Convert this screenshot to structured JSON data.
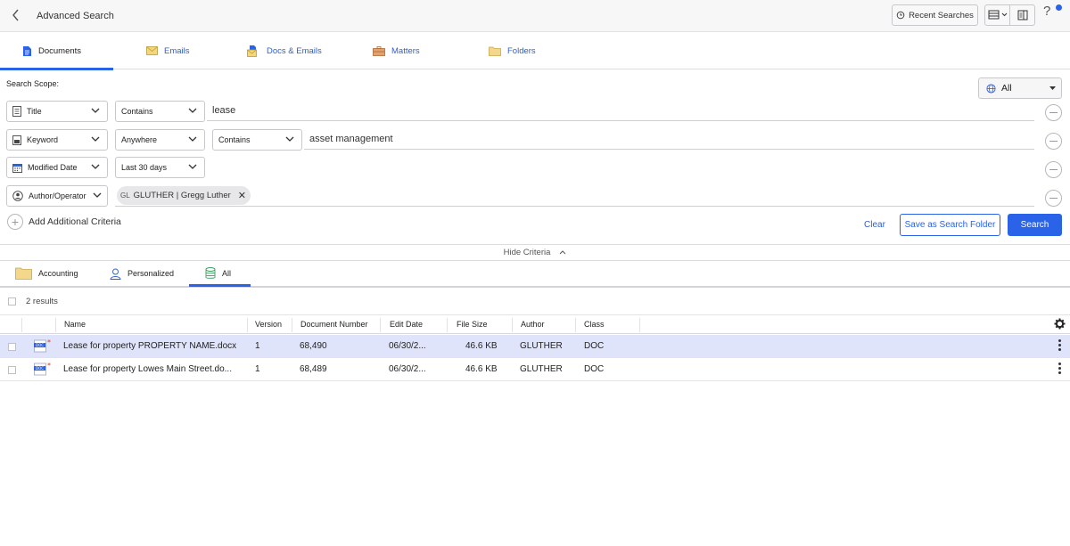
{
  "header": {
    "title": "Advanced Search",
    "recent_searches_label": "Recent Searches"
  },
  "type_tabs": [
    {
      "label": "Documents",
      "icon": "document-icon",
      "active": true
    },
    {
      "label": "Emails",
      "icon": "email-icon",
      "active": false
    },
    {
      "label": "Docs & Emails",
      "icon": "docs-emails-icon",
      "active": false
    },
    {
      "label": "Matters",
      "icon": "briefcase-icon",
      "active": false
    },
    {
      "label": "Folders",
      "icon": "folder-icon",
      "active": false
    }
  ],
  "criteria": {
    "scope_label": "Search Scope:",
    "scope_value": "All",
    "rows": [
      {
        "field": "Title",
        "operator": "Contains",
        "value": "lease"
      },
      {
        "field": "Keyword",
        "location": "Anywhere",
        "operator": "Contains",
        "value": "asset management"
      },
      {
        "field": "Modified Date",
        "range": "Last 30 days"
      },
      {
        "field": "Author/Operator",
        "chip_initials": "GL",
        "chip_label": "GLUTHER | Gregg Luther"
      }
    ],
    "add_label": "Add Additional Criteria",
    "clear_label": "Clear",
    "save_folder_label": "Save as Search Folder",
    "search_label": "Search",
    "hide_label": "Hide Criteria"
  },
  "folder_tabs": [
    {
      "label": "Accounting",
      "icon": "folder-icon",
      "active": false
    },
    {
      "label": "Personalized",
      "icon": "person-icon",
      "active": false
    },
    {
      "label": "All",
      "icon": "database-icon",
      "active": true
    }
  ],
  "results": {
    "count_label": "2 results",
    "columns": [
      "Name",
      "Version",
      "Document Number",
      "Edit Date",
      "File Size",
      "Author",
      "Class"
    ],
    "rows": [
      {
        "name": "Lease for property PROPERTY NAME.docx",
        "version": "1",
        "doc_number": "68,490",
        "edit_date": "06/30/2...",
        "file_size": "46.6 KB",
        "author": "GLUTHER",
        "class": "DOC",
        "selected": true
      },
      {
        "name": "Lease for property Lowes Main Street.do...",
        "version": "1",
        "doc_number": "68,489",
        "edit_date": "06/30/2...",
        "file_size": "46.6 KB",
        "author": "GLUTHER",
        "class": "DOC",
        "selected": false
      }
    ]
  },
  "colors": {
    "accent": "#2a62e8",
    "link": "#2f5fc4",
    "selected_row": "#dfe4fa"
  }
}
